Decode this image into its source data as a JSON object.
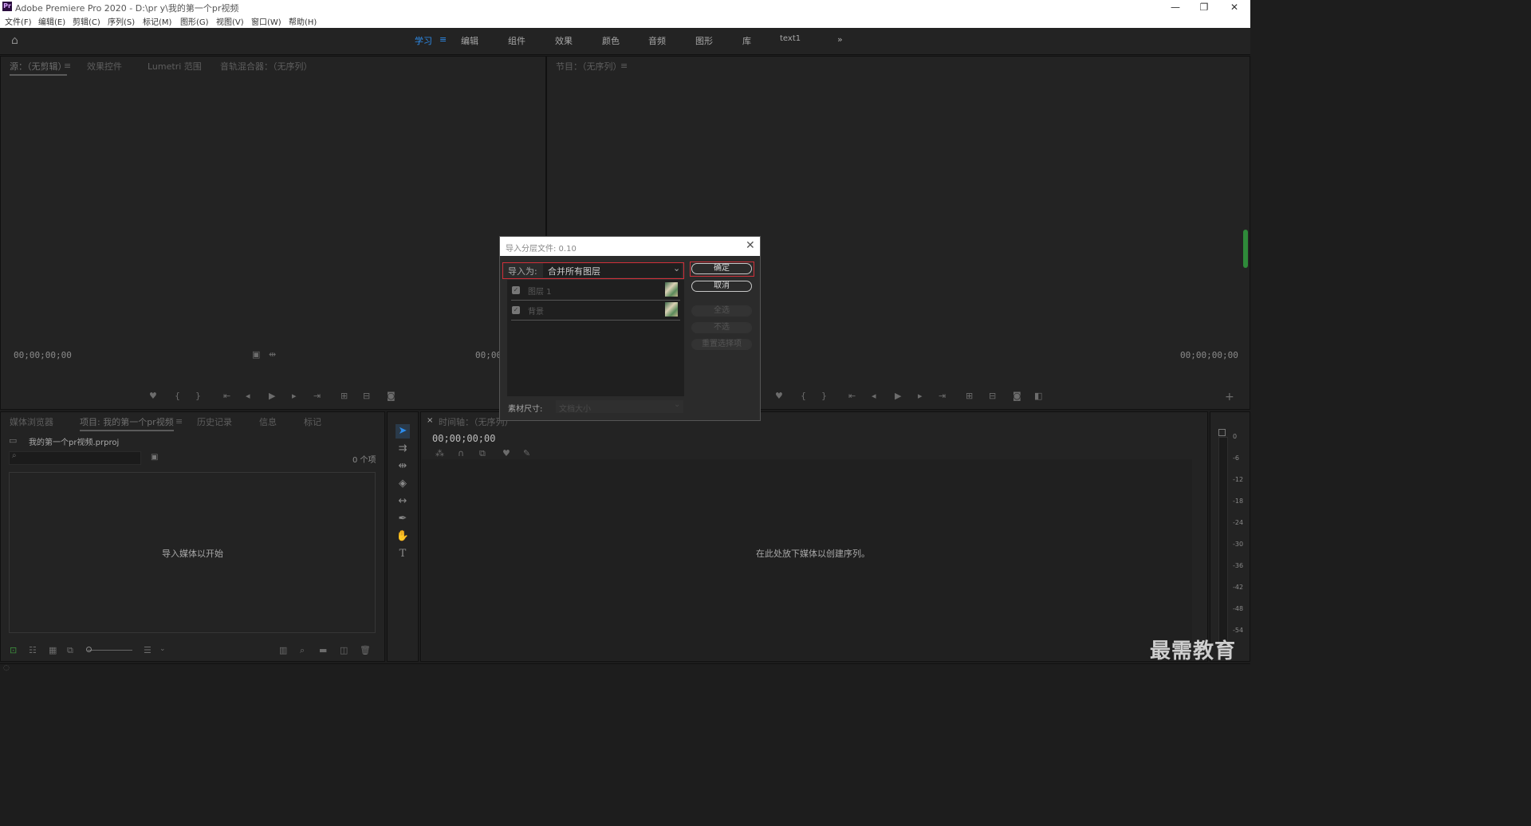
{
  "app": {
    "title": "Adobe Premiere Pro 2020 - D:\\pr y\\我的第一个pr视频",
    "logo": "Pr",
    "window_controls": [
      "—",
      "❐",
      "✕"
    ]
  },
  "menu": [
    "文件(F)",
    "编辑(E)",
    "剪辑(C)",
    "序列(S)",
    "标记(M)",
    "图形(G)",
    "视图(V)",
    "窗口(W)",
    "帮助(H)"
  ],
  "workspaces": {
    "items": [
      "学习",
      "编辑",
      "组件",
      "效果",
      "颜色",
      "音频",
      "图形",
      "库",
      "text1"
    ],
    "active_index": 0,
    "more": "»"
  },
  "source_panel": {
    "tabs": [
      "源：（无剪辑）",
      "效果控件",
      "Lumetri 范围",
      "音轨混合器：（无序列）"
    ],
    "timecode_left": "00;00;00;00",
    "timecode_right": "00;00"
  },
  "program_panel": {
    "tab": "节目：（无序列）",
    "timecode": "00;00;00;00"
  },
  "project_panel": {
    "tabs": [
      "媒体浏览器",
      "项目: 我的第一个pr视频",
      "历史记录",
      "信息",
      "标记"
    ],
    "file": "我的第一个pr视频.prproj",
    "count": "0 个项",
    "empty_hint": "导入媒体以开始"
  },
  "timeline_panel": {
    "tab": "时间轴：（无序列）",
    "timecode": "00;00;00;00",
    "empty_hint": "在此处放下媒体以创建序列。"
  },
  "audio_meter": {
    "labels": [
      "0",
      "-6",
      "-12",
      "-18",
      "-24",
      "-30",
      "-36",
      "-42",
      "-48",
      "-54"
    ]
  },
  "dialog": {
    "title": "导入分层文件: 0.10",
    "import_as_label": "导入为:",
    "import_as_value": "合并所有图层",
    "layers": [
      {
        "name": "图层 1",
        "checked": true
      },
      {
        "name": "背景",
        "checked": true
      }
    ],
    "footage_size_label": "素材尺寸:",
    "footage_size_value": "文档大小",
    "buttons": {
      "ok": "确定",
      "cancel": "取消",
      "select_all": "全选",
      "select_none": "不选",
      "reset": "重置选择项"
    }
  },
  "watermark": "最需教育"
}
